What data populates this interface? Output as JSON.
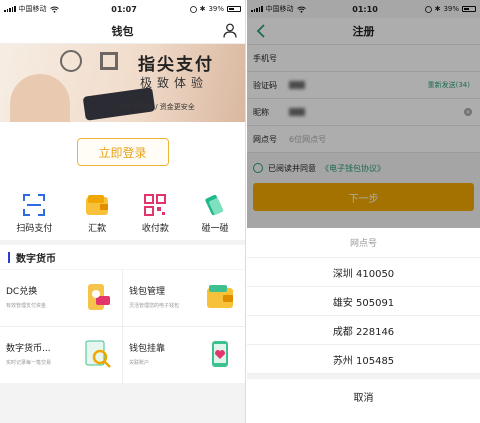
{
  "left": {
    "status": {
      "carrier": "中国移动",
      "time": "01:07",
      "battery": "39%"
    },
    "nav_title": "钱包",
    "banner": {
      "title": "指尖支付",
      "subtitle": "极致体验",
      "tagline": "支付更便捷 / 资金更安全"
    },
    "login_label": "立即登录",
    "quick_actions": [
      {
        "label": "扫码支付",
        "icon": "scan-icon",
        "color": "#2f6be0"
      },
      {
        "label": "汇款",
        "icon": "wallet-icon",
        "color": "#f0a800"
      },
      {
        "label": "收付款",
        "icon": "qrcode-icon",
        "color": "#e2356b"
      },
      {
        "label": "碰一碰",
        "icon": "tap-icon",
        "color": "#1fb88a"
      }
    ],
    "section_title": "数字货币",
    "features": [
      {
        "title": "DC兑换",
        "subtitle": "有效管理支付资金"
      },
      {
        "title": "钱包管理",
        "subtitle": "灵活管理您的电子钱包"
      },
      {
        "title": "数字货币...",
        "subtitle": "实时记录每一笔交易"
      },
      {
        "title": "钱包挂靠",
        "subtitle": "关联账户"
      }
    ]
  },
  "right": {
    "status": {
      "carrier": "中国移动",
      "time": "01:10",
      "battery": "39%"
    },
    "nav_title": "注册",
    "fields": {
      "phone_label": "手机号",
      "code_label": "验证码",
      "resend_label": "重新发送(34)",
      "nickname_label": "昵称",
      "branch_label": "网点号",
      "branch_placeholder": "6位网点号"
    },
    "agree_text": "已阅读并同意",
    "agree_link": "《电子钱包协议》",
    "next_label": "下一步",
    "sheet": {
      "title": "网点号",
      "options": [
        "深圳 410050",
        "雄安 505091",
        "成都 228146",
        "苏州 105485"
      ],
      "cancel": "取消"
    }
  }
}
